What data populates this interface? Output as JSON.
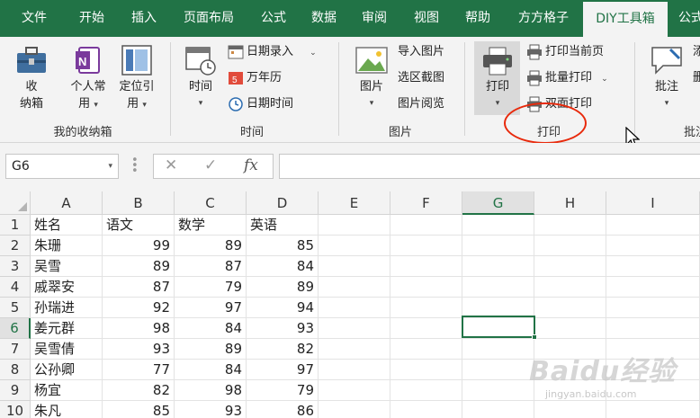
{
  "tabs": [
    {
      "label": "文件"
    },
    {
      "label": "开始"
    },
    {
      "label": "插入"
    },
    {
      "label": "页面布局"
    },
    {
      "label": "公式"
    },
    {
      "label": "数据"
    },
    {
      "label": "审阅"
    },
    {
      "label": "视图"
    },
    {
      "label": "帮助"
    },
    {
      "label": "方方格子"
    },
    {
      "label": "DIY工具箱"
    },
    {
      "label": "公式"
    }
  ],
  "ribbon": {
    "groups": {
      "box": {
        "label": "我的收纳箱",
        "btn1_l1": "收",
        "btn1_l2": "纳箱",
        "btn2_l1": "个人常",
        "btn2_l2": "用",
        "btn3_l1": "定位引",
        "btn3_l2": "用"
      },
      "time": {
        "label": "时间",
        "big": "时间",
        "date_entry": "日期录入",
        "calendar": "万年历",
        "datetime": "日期时间"
      },
      "image": {
        "label": "图片",
        "big": "图片",
        "import": "导入图片",
        "screenshot": "选区截图",
        "browse": "图片阅览"
      },
      "print": {
        "label": "打印",
        "big": "打印",
        "current": "打印当前页",
        "batch": "批量打印",
        "duplex": "双面打印"
      },
      "annot": {
        "label": "批注",
        "big": "批注",
        "partial1": "添",
        "partial2": "删"
      }
    }
  },
  "formula_bar": {
    "name_box": "G6",
    "cancel": "✕",
    "enter": "✓",
    "fx": "fx",
    "content": ""
  },
  "grid": {
    "columns": [
      "A",
      "B",
      "C",
      "D",
      "E",
      "F",
      "G",
      "H",
      "I"
    ],
    "rows": [
      "1",
      "2",
      "3",
      "4",
      "5",
      "6",
      "7",
      "8",
      "9",
      "10"
    ],
    "selected_cell": "G6",
    "header": [
      "姓名",
      "语文",
      "数学",
      "英语"
    ],
    "data": [
      [
        "朱珊",
        "99",
        "89",
        "85"
      ],
      [
        "吴雪",
        "89",
        "87",
        "84"
      ],
      [
        "戚翠安",
        "87",
        "79",
        "89"
      ],
      [
        "孙瑞进",
        "92",
        "97",
        "94"
      ],
      [
        "姜元群",
        "98",
        "84",
        "93"
      ],
      [
        "吴雪倩",
        "93",
        "89",
        "82"
      ],
      [
        "公孙卿",
        "77",
        "84",
        "97"
      ],
      [
        "杨宜",
        "82",
        "98",
        "79"
      ],
      [
        "朱凡",
        "85",
        "93",
        "86"
      ]
    ]
  },
  "watermark": {
    "logo": "Baidu经验",
    "url": "jingyan.baidu.com"
  },
  "colors": {
    "excel_green": "#217346",
    "annotation_red": "#e8290b"
  }
}
